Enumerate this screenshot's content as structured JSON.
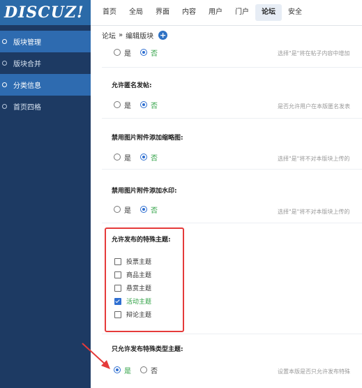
{
  "sidebar": {
    "logo": "DISCUZ!",
    "items": [
      {
        "label": "版块管理",
        "active": true
      },
      {
        "label": "版块合并",
        "active": false
      },
      {
        "label": "分类信息",
        "active": true
      },
      {
        "label": "首页四格",
        "active": false
      }
    ]
  },
  "topnav": {
    "items": [
      "首页",
      "全局",
      "界面",
      "内容",
      "用户",
      "门户",
      "论坛",
      "安全"
    ],
    "active_index": 6
  },
  "breadcrumb": {
    "parent": "论坛",
    "separator": "»",
    "current": "编辑版块",
    "add_icon": "plus-icon"
  },
  "settings": {
    "row0": {
      "yes": "是",
      "no": "否",
      "selected": "no",
      "hint": "选择\"是\"将在帖子内容中增加"
    },
    "row1": {
      "label": "允许匿名发帖:",
      "yes": "是",
      "no": "否",
      "selected": "no",
      "hint": "是否允许用户在本版匿名发表"
    },
    "row2": {
      "label": "禁用图片附件添加缩略图:",
      "yes": "是",
      "no": "否",
      "selected": "no",
      "hint": "选择\"是\"将不对本版块上传的"
    },
    "row3": {
      "label": "禁用图片附件添加水印:",
      "yes": "是",
      "no": "否",
      "selected": "no",
      "hint": "选择\"是\"将不对本版块上传的"
    },
    "special": {
      "label": "允许发布的特殊主题:",
      "options": [
        {
          "label": "投票主题",
          "checked": false
        },
        {
          "label": "商品主题",
          "checked": false
        },
        {
          "label": "悬赏主题",
          "checked": false
        },
        {
          "label": "活动主题",
          "checked": true
        },
        {
          "label": "辩论主题",
          "checked": false
        }
      ]
    },
    "only_special": {
      "label": "只允许发布特殊类型主题:",
      "yes": "是",
      "no": "否",
      "selected": "yes",
      "hint": "设置本版是否只允许发布特殊"
    }
  },
  "colors": {
    "sidebar": "#1d3a63",
    "accent": "#2f6fd1",
    "selected_text": "#2ea043",
    "highlight": "#e53a3a"
  }
}
